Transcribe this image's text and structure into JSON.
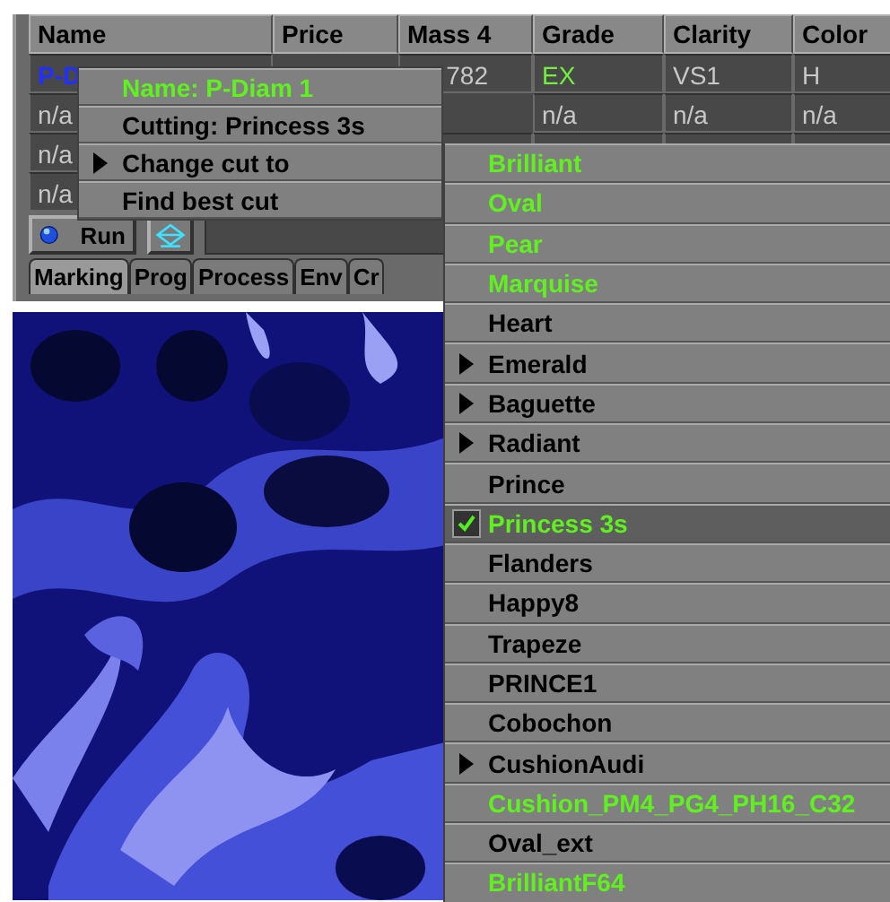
{
  "table": {
    "columns": [
      "Name",
      "Price",
      "Mass 4",
      "Grade",
      "Clarity",
      "Color"
    ],
    "rows": [
      {
        "selected": true,
        "cells": [
          {
            "text": "P-D",
            "accent": false
          },
          {
            "text": ""
          },
          {
            "text": "782",
            "accent": false
          },
          {
            "text": "EX",
            "accent": true
          },
          {
            "text": "VS1",
            "accent": false
          },
          {
            "text": "H",
            "accent": false
          }
        ]
      },
      {
        "selected": false,
        "cells": [
          {
            "text": "n/a",
            "accent": false
          },
          {
            "text": ""
          },
          {
            "text": ""
          },
          {
            "text": "n/a",
            "accent": false
          },
          {
            "text": "n/a",
            "accent": false
          },
          {
            "text": "n/a",
            "accent": false
          }
        ]
      },
      {
        "selected": false,
        "cells": [
          {
            "text": "n/a",
            "accent": false
          }
        ]
      },
      {
        "selected": false,
        "cells": [
          {
            "text": "n/a",
            "accent": false
          }
        ]
      }
    ]
  },
  "toolbar": {
    "run_label": "Run"
  },
  "tabs": [
    {
      "label": "Marking",
      "selected": true
    },
    {
      "label": "Prog",
      "selected": false
    },
    {
      "label": "Process",
      "selected": false
    },
    {
      "label": "Env",
      "selected": false
    },
    {
      "label": "Cr",
      "selected": false
    }
  ],
  "context_menu": [
    {
      "label": "Name: P-Diam 1",
      "kind": "title",
      "submenu": false
    },
    {
      "label": "Cutting: Princess 3s",
      "kind": "info",
      "submenu": false
    },
    {
      "label": "Change cut to",
      "kind": "action",
      "submenu": true
    },
    {
      "label": "Find best cut",
      "kind": "action",
      "submenu": false
    }
  ],
  "cut_menu": [
    {
      "label": "Brilliant",
      "green": true,
      "submenu": false,
      "checked": false
    },
    {
      "label": "Oval",
      "green": true,
      "submenu": false,
      "checked": false
    },
    {
      "label": "Pear",
      "green": true,
      "submenu": false,
      "checked": false
    },
    {
      "label": "Marquise",
      "green": true,
      "submenu": false,
      "checked": false
    },
    {
      "label": "Heart",
      "green": false,
      "submenu": false,
      "checked": false
    },
    {
      "label": "Emerald",
      "green": false,
      "submenu": true,
      "checked": false
    },
    {
      "label": "Baguette",
      "green": false,
      "submenu": true,
      "checked": false
    },
    {
      "label": "Radiant",
      "green": false,
      "submenu": true,
      "checked": false
    },
    {
      "label": "Prince",
      "green": false,
      "submenu": false,
      "checked": false
    },
    {
      "label": "Princess 3s",
      "green": true,
      "submenu": false,
      "checked": true
    },
    {
      "label": "Flanders",
      "green": false,
      "submenu": false,
      "checked": false
    },
    {
      "label": "Happy8",
      "green": false,
      "submenu": false,
      "checked": false
    },
    {
      "label": "Trapeze",
      "green": false,
      "submenu": false,
      "checked": false
    },
    {
      "label": "PRINCE1",
      "green": false,
      "submenu": false,
      "checked": false
    },
    {
      "label": "Cobochon",
      "green": false,
      "submenu": false,
      "checked": false
    },
    {
      "label": "CushionAudi",
      "green": false,
      "submenu": true,
      "checked": false
    },
    {
      "label": "Cushion_PM4_PG4_PH16_C32",
      "green": true,
      "submenu": false,
      "checked": false
    },
    {
      "label": "Oval_ext",
      "green": false,
      "submenu": false,
      "checked": false
    },
    {
      "label": "BrilliantF64",
      "green": true,
      "submenu": false,
      "checked": false
    }
  ]
}
